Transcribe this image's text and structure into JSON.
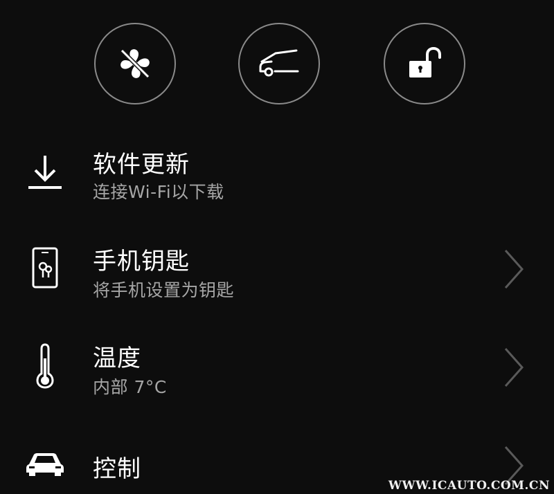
{
  "quick_actions": [
    {
      "icon": "fan-off-icon"
    },
    {
      "icon": "frunk-open-icon"
    },
    {
      "icon": "unlock-icon"
    }
  ],
  "menu": {
    "software_update": {
      "title": "软件更新",
      "subtitle": "连接Wi-Fi以下载",
      "icon": "download-icon"
    },
    "phone_key": {
      "title": "手机钥匙",
      "subtitle": "将手机设置为钥匙",
      "icon": "phone-key-icon"
    },
    "temperature": {
      "title": "温度",
      "subtitle": "内部 7°C",
      "icon": "thermometer-icon"
    },
    "controls": {
      "title": "控制",
      "icon": "car-icon"
    }
  },
  "watermark": "WWW.ICAUTO.COM.CN",
  "colors": {
    "background": "#0d0d0d",
    "text": "#ffffff",
    "subtext": "#a6a6a6",
    "circle_border": "#8a8a8a",
    "chevron": "#5a5a5a"
  }
}
